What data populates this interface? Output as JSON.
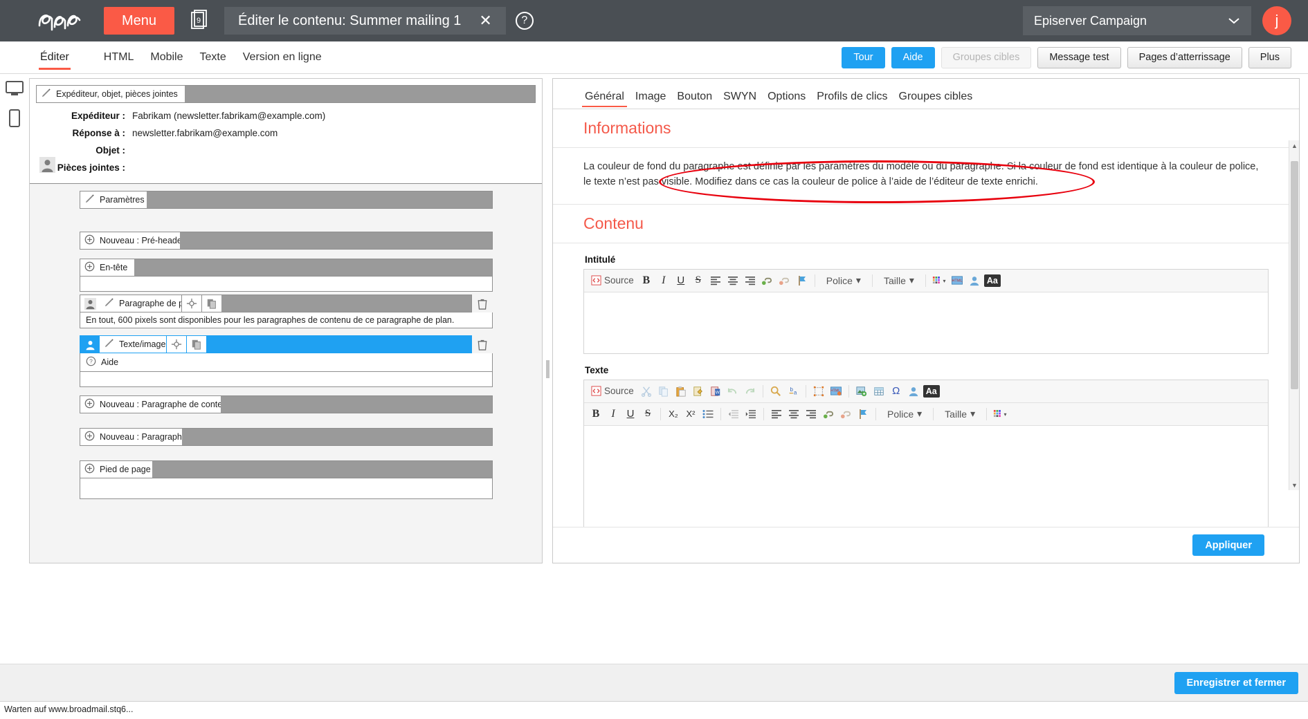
{
  "topbar": {
    "logo_alt": "Episerver logo",
    "menu_label": "Menu",
    "doc_badge": "9",
    "title": "Éditer le contenu: Summer mailing 1",
    "close_label": "✕",
    "help_label": "?",
    "client_name": "Episerver Campaign",
    "client_chevron": "⌄",
    "avatar_initial": "j"
  },
  "subbar": {
    "tabs": [
      {
        "label": "Éditer",
        "active": true
      },
      {
        "label": "HTML",
        "active": false
      },
      {
        "label": "Mobile",
        "active": false
      },
      {
        "label": "Texte",
        "active": false
      },
      {
        "label": "Version en ligne",
        "active": false
      }
    ],
    "buttons": [
      {
        "label": "Tour",
        "style": "blue"
      },
      {
        "label": "Aide",
        "style": "blue"
      },
      {
        "label": "Groupes cibles",
        "style": "disabled"
      },
      {
        "label": "Message test",
        "style": "normal"
      },
      {
        "label": "Pages d’atterrissage",
        "style": "normal"
      },
      {
        "label": "Plus",
        "style": "normal"
      }
    ]
  },
  "device_rail": {
    "desktop_icon": "desktop-icon",
    "mobile_icon": "mobile-icon"
  },
  "editor": {
    "meta_header_label": "Expéditeur, objet, pièces jointes",
    "fields": [
      {
        "label": "Expéditeur :",
        "value": "Fabrikam (newsletter.fabrikam@example.com)"
      },
      {
        "label": "Réponse à :",
        "value": "newsletter.fabrikam@example.com"
      },
      {
        "label": "Objet :",
        "value": ""
      },
      {
        "label": "Pièces jointes :",
        "value": ""
      }
    ],
    "blocks": [
      {
        "kind": "edit",
        "label": "Paramètres",
        "fill": "grey",
        "label_width": 96,
        "icon": "pencil-icon"
      },
      {
        "kind": "add",
        "label": "Nouveau : Pré-header",
        "fill": "grey",
        "label_width": 144,
        "icon": "plus-circle-icon"
      },
      {
        "kind": "add",
        "label": "En-tête",
        "fill": "grey",
        "label_width": 78,
        "icon": "plus-circle-icon"
      },
      {
        "kind": "para",
        "label": "Paragraphe de plan",
        "fill": "grey",
        "label_width": 146,
        "icon": "pencil-icon",
        "hint": "En tout, 600 pixels sont disponibles pour les paragraphes de contenu de ce paragraphe de plan."
      },
      {
        "kind": "para-selected",
        "label": "Texte/image",
        "fill": "blue",
        "label_width": 104,
        "icon": "pencil-icon",
        "hint": "Aide"
      },
      {
        "kind": "add",
        "label": "Nouveau : Paragraphe de contenu",
        "fill": "grey",
        "label_width": 203,
        "icon": "plus-circle-icon"
      },
      {
        "kind": "add",
        "label": "Nouveau : Paragraphe",
        "fill": "grey",
        "label_width": 147,
        "icon": "plus-circle-icon"
      },
      {
        "kind": "add",
        "label": "Pied de page",
        "fill": "grey",
        "label_width": 104,
        "icon": "plus-circle-icon"
      }
    ]
  },
  "properties": {
    "tabs": [
      {
        "label": "Général",
        "active": true
      },
      {
        "label": "Image",
        "active": false
      },
      {
        "label": "Bouton",
        "active": false
      },
      {
        "label": "SWYN",
        "active": false
      },
      {
        "label": "Options",
        "active": false
      },
      {
        "label": "Profils de clics",
        "active": false
      },
      {
        "label": "Groupes cibles",
        "active": false
      }
    ],
    "info_title": "Informations",
    "info_text": "La couleur de fond du paragraphe est définie par les paramètres du modèle ou du paragraphe. Si la couleur de fond est identique à la couleur de police, le texte n’est pas visible. Modifiez dans ce cas la couleur de police à l’aide de l’éditeur de texte enrichi.",
    "content_title": "Contenu",
    "intitule_label": "Intitulé",
    "texte_label": "Texte",
    "intitule_value": "",
    "texte_value": "",
    "editor_toolbar": {
      "source_label": "Source",
      "police_label": "Police",
      "taille_label": "Taille",
      "aa_label": "Aa",
      "bold": "B",
      "italic": "I",
      "underline": "U",
      "strike": "S",
      "subscript": "X₂",
      "superscript": "X²",
      "omega": "Ω"
    },
    "apply_label": "Appliquer"
  },
  "bottom": {
    "save_label": "Enregistrer et fermer",
    "status_text": "Warten auf www.broadmail.stq6..."
  },
  "colors": {
    "brand_orange": "#fa5a46",
    "accent_blue": "#1fa1f2",
    "topbar_bg": "#4a4f54",
    "section_title": "#f4594a",
    "annotation_red": "#e8000d"
  }
}
